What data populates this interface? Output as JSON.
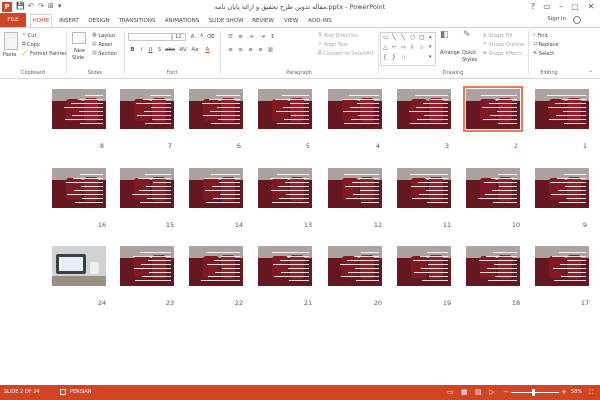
{
  "app": {
    "logo": "P",
    "window_title": "مقاله تدوین طرح تحقیق و ارائه پایان نامه.pptx - PowerPoint",
    "sign_in": "Sign in",
    "window_controls": [
      "?",
      "▭",
      "–",
      "▢",
      "✕"
    ]
  },
  "quick_access": {
    "save": "💾",
    "undo": "↶",
    "redo": "↷",
    "start": "⊞",
    "more": "▾"
  },
  "tabs": [
    "FILE",
    "HOME",
    "INSERT",
    "DESIGN",
    "TRANSITIONS",
    "ANIMATIONS",
    "SLIDE SHOW",
    "REVIEW",
    "VIEW",
    "ADD-INS"
  ],
  "ribbon": {
    "clipboard": {
      "paste": "Paste",
      "cut": "Cut",
      "copy": "Copy",
      "format_painter": "Format Painter",
      "label": "Clipboard"
    },
    "slides": {
      "new_slide": "New",
      "new_slide2": "Slide",
      "layout": "Layout",
      "reset": "Reset",
      "section": "Section",
      "label": "Slides"
    },
    "font": {
      "font_size": "12",
      "label": "Font",
      "bold": "B",
      "italic": "I",
      "underline": "U",
      "shadow": "S",
      "strike": "abc",
      "spacing": "AV",
      "case": "Aa",
      "grow": "A",
      "shrink": "A"
    },
    "paragraph": {
      "text_direction": "Text Direction",
      "align_text": "Align Text",
      "smartart": "Convert to SmartArt",
      "label": "Paragraph"
    },
    "drawing": {
      "arrange": "Arrange",
      "quick_styles": "Quick",
      "quick_styles2": "Styles",
      "shape_fill": "Shape Fill",
      "shape_outline": "Shape Outline",
      "shape_effects": "Shape Effects",
      "label": "Drawing"
    },
    "editing": {
      "find": "Find",
      "replace": "Replace",
      "select": "Select",
      "label": "Editing"
    }
  },
  "slides": {
    "row1": [
      "8",
      "7",
      "6",
      "5",
      "4",
      "3",
      "2",
      "1"
    ],
    "row2": [
      "16",
      "15",
      "14",
      "13",
      "12",
      "11",
      "10",
      "9"
    ],
    "row3": [
      "24",
      "23",
      "22",
      "21",
      "20",
      "19",
      "18",
      "17"
    ],
    "selected": "2",
    "photo_slide": "24"
  },
  "statusbar": {
    "slide": "SLIDE 2 OF 24",
    "language": "PERSIAN",
    "zoom": "58%"
  },
  "colors": {
    "accent": "#d04526",
    "selected_outline": "#e8795f"
  }
}
